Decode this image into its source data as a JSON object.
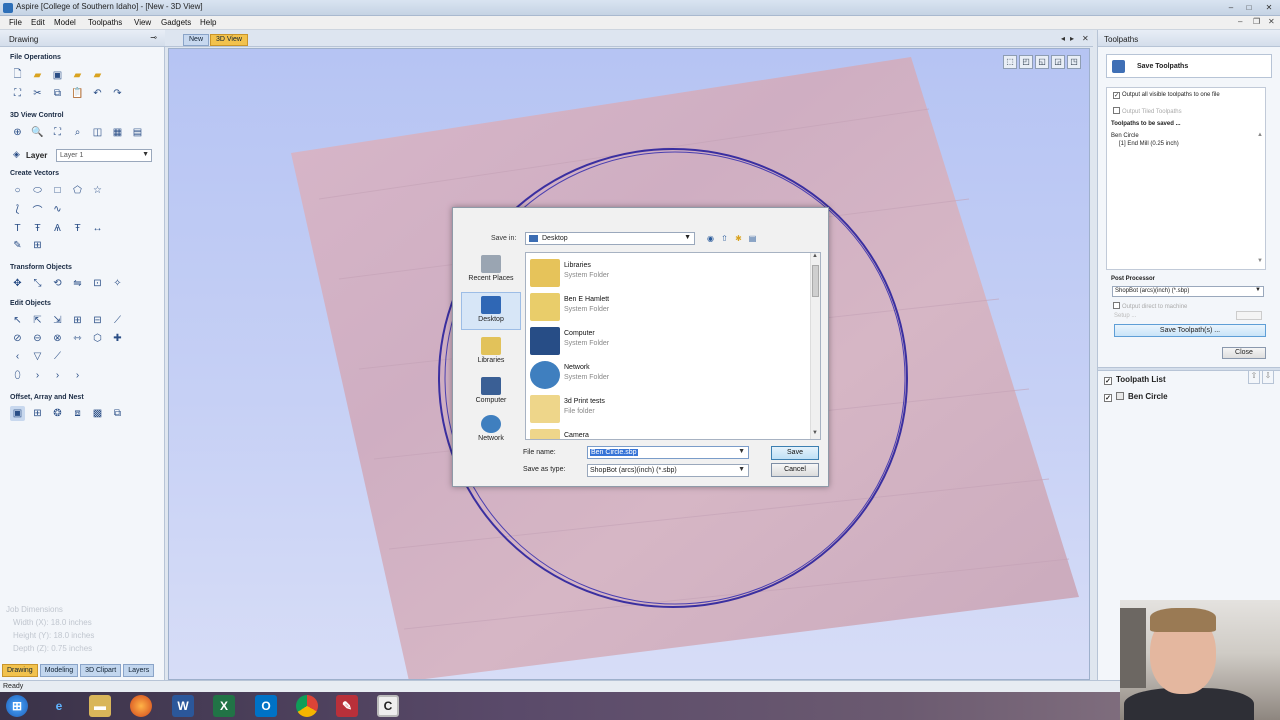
{
  "window": {
    "title": "Aspire [College of Southern Idaho] - [New - 3D View]",
    "controls": [
      "–",
      "□",
      "✕"
    ]
  },
  "menu": [
    "File",
    "Edit",
    "Model",
    "Toolpaths",
    "View",
    "Gadgets",
    "Help"
  ],
  "left_panel": {
    "title": "Drawing",
    "sections": {
      "file_ops": "File Operations",
      "view_control": "3D View Control",
      "create_vectors": "Create Vectors",
      "transform": "Transform Objects",
      "edit_objects": "Edit Objects",
      "offset": "Offset, Array and Nest"
    },
    "layer_label": "Layer",
    "layer_value": "Layer 1",
    "job_dimensions": {
      "title": "Job Dimensions",
      "width": "Width  (X): 18.0 inches",
      "height": "Height (Y): 18.0 inches",
      "depth": "Depth  (Z): 0.75 inches"
    },
    "bottom_tabs": [
      "Drawing",
      "Modeling",
      "3D Clipart",
      "Layers"
    ]
  },
  "view_tabs": [
    "New",
    "3D View"
  ],
  "dialog": {
    "save_in_label": "Save in:",
    "save_in_value": "Desktop",
    "places": [
      "Recent Places",
      "Desktop",
      "Libraries",
      "Computer",
      "Network"
    ],
    "files": [
      {
        "name": "Libraries",
        "type": "System Folder"
      },
      {
        "name": "Ben E Hamlett",
        "type": "System Folder"
      },
      {
        "name": "Computer",
        "type": "System Folder"
      },
      {
        "name": "Network",
        "type": "System Folder"
      },
      {
        "name": "3d Print tests",
        "type": "File folder"
      },
      {
        "name": "Camera",
        "type": ""
      }
    ],
    "file_name_label": "File name:",
    "file_name_value": "Ben Circle.sbp",
    "save_as_type_label": "Save as type:",
    "save_as_type_value": "ShopBot (arcs)(inch) (*.sbp)",
    "save_button": "Save",
    "cancel_button": "Cancel"
  },
  "right_panel": {
    "title": "Toolpaths",
    "save_title": "Save Toolpaths",
    "opt_all": "Output all visible toolpaths to one file",
    "opt_tiled": "Output Tiled Toolpaths",
    "to_be_saved_label": "Toolpaths to be saved ...",
    "saved_items": [
      "Ben Circle",
      "[1] End Mill (0.25 inch)"
    ],
    "post_processor_label": "Post Processor",
    "post_processor_value": "ShopBot (arcs)(inch) (*.sbp)",
    "opt_direct": "Output direct to machine",
    "opt_direct_sub": "Setup ...",
    "save_button": "Save Toolpath(s) ...",
    "close_button": "Close",
    "list_title": "Toolpath List",
    "list_items": [
      "Ben Circle"
    ]
  },
  "status": "Ready",
  "colors": {
    "accent_tab": "#f2c24d",
    "view_bg": "#b6c4f3",
    "circle": "#3a2fa0"
  }
}
